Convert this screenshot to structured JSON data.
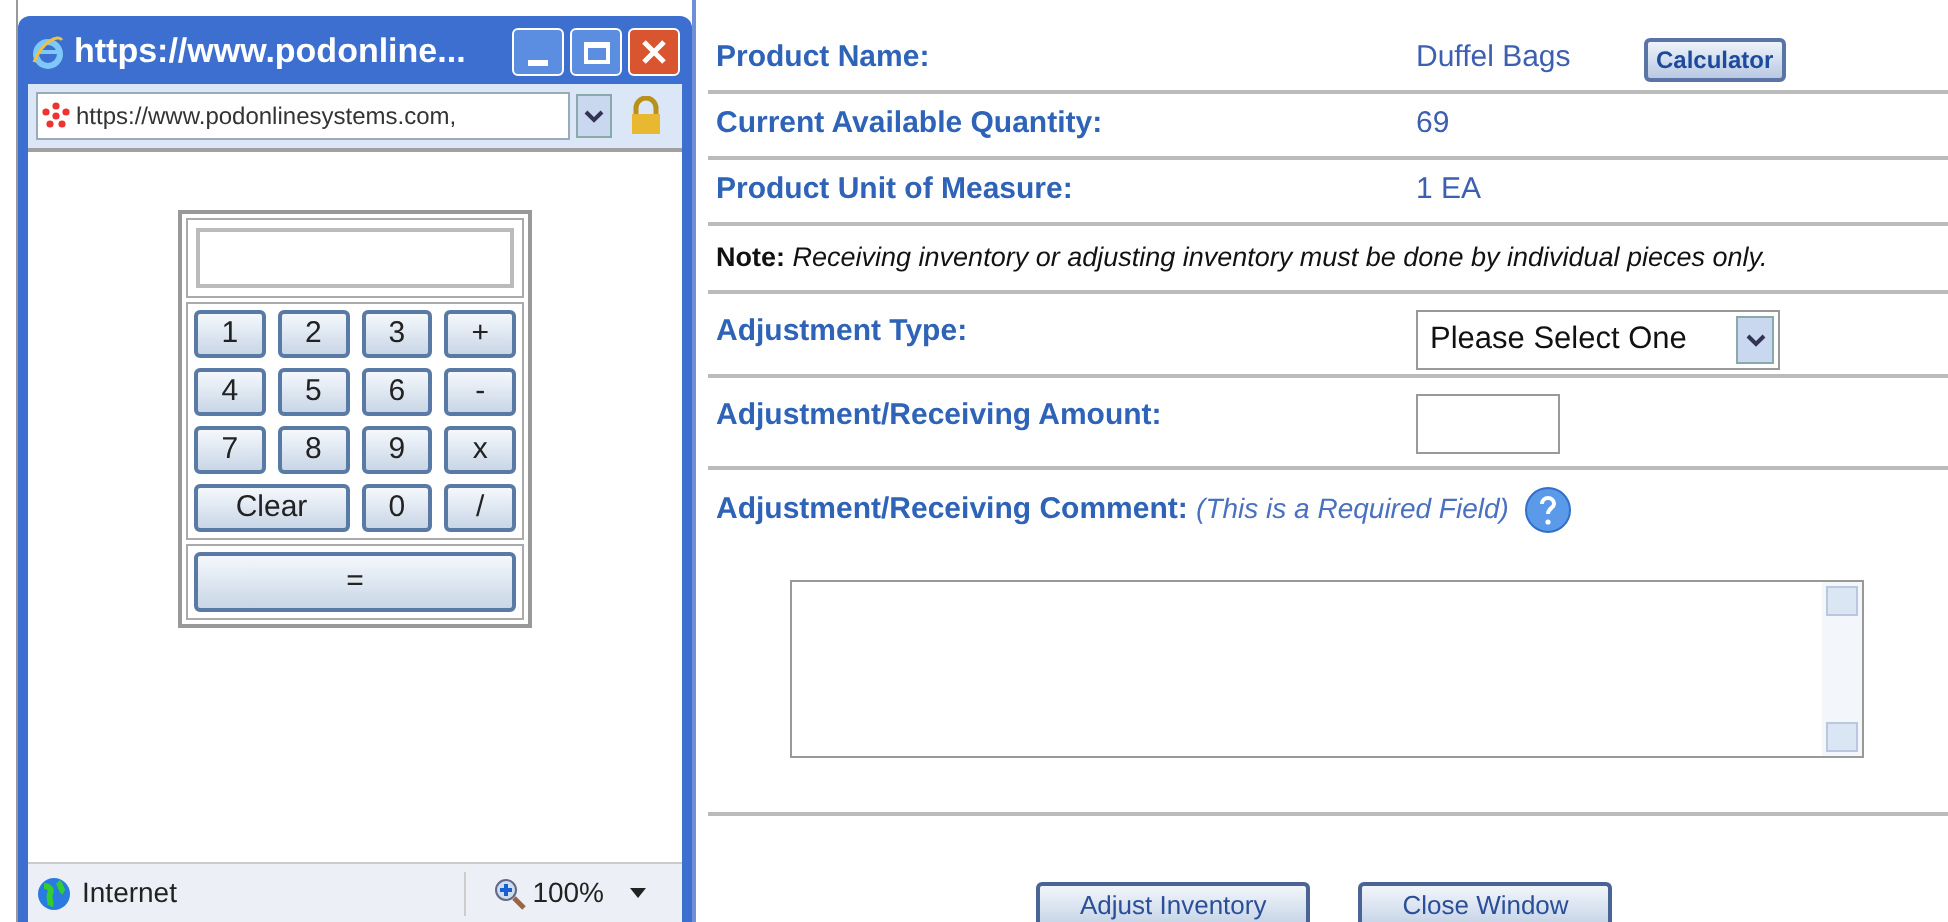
{
  "popup": {
    "title": "https://www.podonline...",
    "address": "https://www.podonlinesystems.com,",
    "calculator": {
      "keys": [
        {
          "label": "1",
          "kind": "key"
        },
        {
          "label": "2",
          "kind": "key"
        },
        {
          "label": "3",
          "kind": "key"
        },
        {
          "label": "+",
          "kind": "key"
        },
        {
          "label": "4",
          "kind": "key"
        },
        {
          "label": "5",
          "kind": "key"
        },
        {
          "label": "6",
          "kind": "key"
        },
        {
          "label": "-",
          "kind": "key"
        },
        {
          "label": "7",
          "kind": "key"
        },
        {
          "label": "8",
          "kind": "key"
        },
        {
          "label": "9",
          "kind": "key"
        },
        {
          "label": "x",
          "kind": "key"
        },
        {
          "label": "Clear",
          "kind": "wide"
        },
        {
          "label": "0",
          "kind": "key"
        },
        {
          "label": "/",
          "kind": "key"
        }
      ],
      "equals": "="
    },
    "status_bar": {
      "zone": "Internet",
      "zoom": "100%"
    }
  },
  "form": {
    "info_rows": [
      {
        "label": "Product Name:",
        "value": "Duffel Bags",
        "button": "Calculator"
      },
      {
        "label": "Current Available Quantity:",
        "value": "69"
      },
      {
        "label": "Product Unit of Measure:",
        "value": "1 EA"
      }
    ],
    "note": {
      "label": "Note:",
      "text": "Receiving inventory or adjusting inventory must be done by individual pieces only."
    },
    "adjustment_type": {
      "label": "Adjustment Type:",
      "value": "Please Select One"
    },
    "amount": {
      "label": "Adjustment/Receiving Amount:"
    },
    "comment": {
      "label": "Adjustment/Receiving Comment:",
      "hint": "(This is a Required Field)"
    },
    "buttons": [
      "Adjust Inventory",
      "Close Window"
    ]
  }
}
